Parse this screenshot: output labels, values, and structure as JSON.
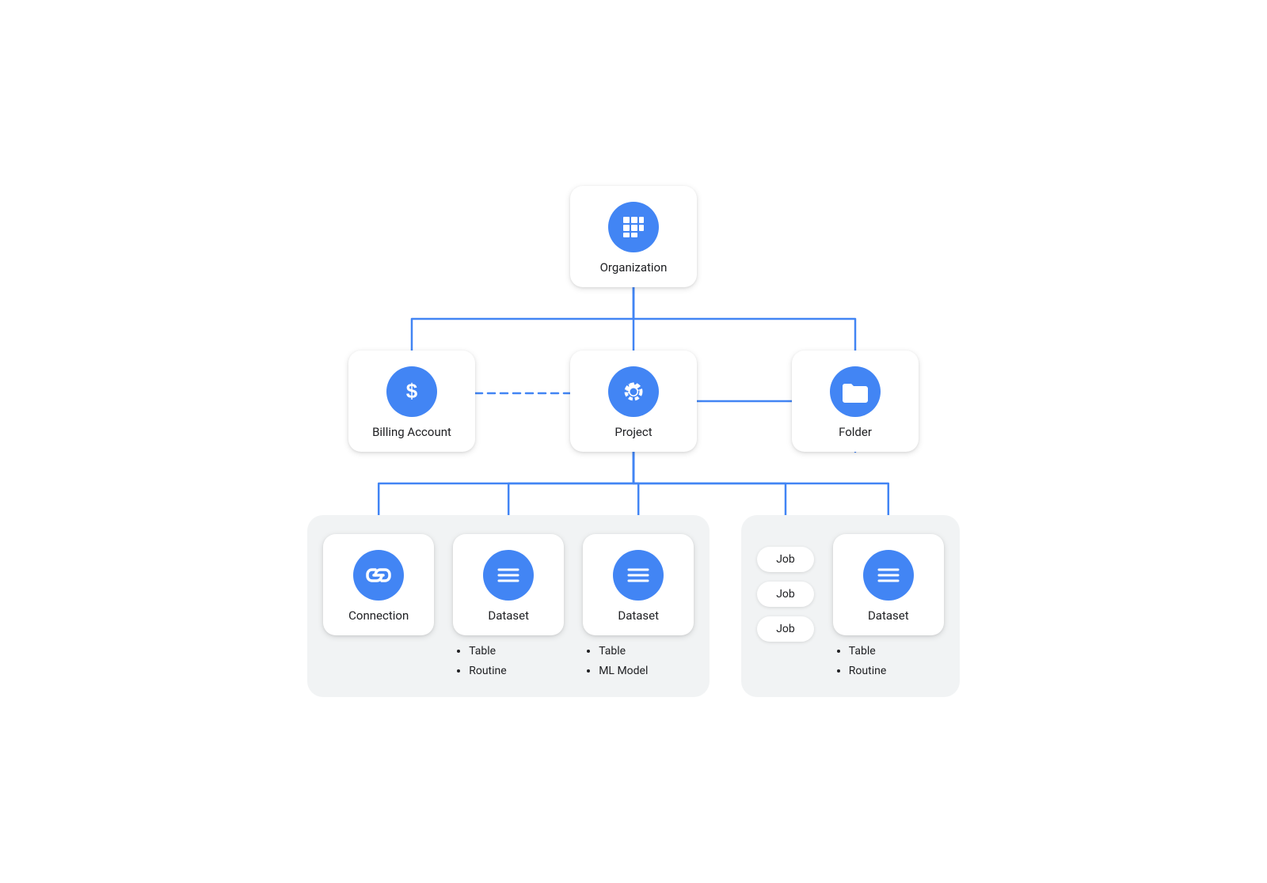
{
  "nodes": {
    "organization": {
      "label": "Organization",
      "icon": "grid"
    },
    "billing_account": {
      "label": "Billing Account",
      "icon": "dollar"
    },
    "folder": {
      "label": "Folder",
      "icon": "folder"
    },
    "project": {
      "label": "Project",
      "icon": "gear"
    },
    "connection": {
      "label": "Connection",
      "icon": "link"
    },
    "dataset1": {
      "label": "Dataset",
      "icon": "list",
      "bullets": [
        "Table",
        "Routine"
      ]
    },
    "dataset2": {
      "label": "Dataset",
      "icon": "list",
      "bullets": [
        "Table",
        "ML Model"
      ]
    },
    "dataset3": {
      "label": "Dataset",
      "icon": "list",
      "bullets": [
        "Table",
        "Routine"
      ]
    }
  },
  "jobs": [
    "Job",
    "Job",
    "Job"
  ],
  "colors": {
    "blue": "#4285F4",
    "connector": "#4285F4"
  }
}
